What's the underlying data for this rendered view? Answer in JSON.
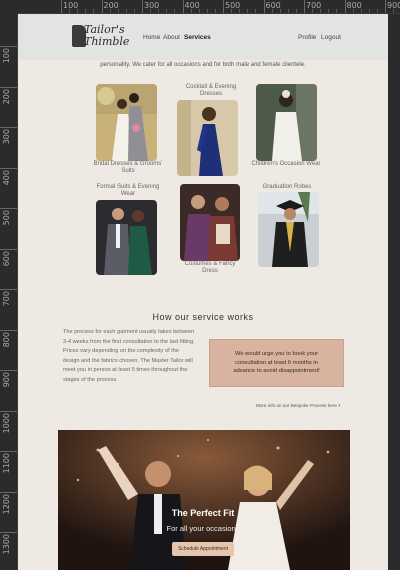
{
  "ruler": {
    "top_labels": [
      "100",
      "200",
      "300",
      "400",
      "500",
      "600",
      "700",
      "800",
      "900"
    ],
    "left_labels": [
      "100",
      "200",
      "300",
      "400",
      "500",
      "600",
      "700",
      "800",
      "900",
      "1000",
      "1100",
      "1200",
      "1300"
    ]
  },
  "header": {
    "logo_line1": "Tailor's",
    "logo_line2": "Thimble",
    "nav": {
      "home": "Home",
      "about": "About",
      "services": "Services",
      "profile": "Profile",
      "logout": "Logout"
    }
  },
  "intro": "personality. We cater for all occasions and for both male and female clientele.",
  "services": [
    {
      "caption": "Bridal Dresses & Grooms' Suits"
    },
    {
      "caption": "Cocktail & Evening Dresses"
    },
    {
      "caption": "Children's Occasion Wear"
    },
    {
      "caption": "Formal Suits & Evening Wear"
    },
    {
      "caption": "Costumes & Fancy Dress"
    },
    {
      "caption": "Graduation Robes"
    }
  ],
  "how": {
    "title": "How our service works",
    "text": "The process for each garment usually takes between 3-4 weeks from the first consultation to the last fitting. Prices vary depending on the complexity of the design and the fabrics chosen. The Master Tailor will meet you in person at least 5 times throughout the stages of the process.",
    "notice": "We would urge you to book your consultation at least 6 months in advance to avoid disappointment!",
    "more_link": "More info on our Bespoke Process here"
  },
  "hero": {
    "title": "The Perfect Fit",
    "subtitle": "For all your occasions",
    "button": "Schedule Appointment"
  },
  "colors": {
    "page_bg": "#efe9e4",
    "header_bg": "#e2e4e2",
    "notice_bg": "#d8b4a0",
    "button_bg": "#e5c5ad"
  }
}
